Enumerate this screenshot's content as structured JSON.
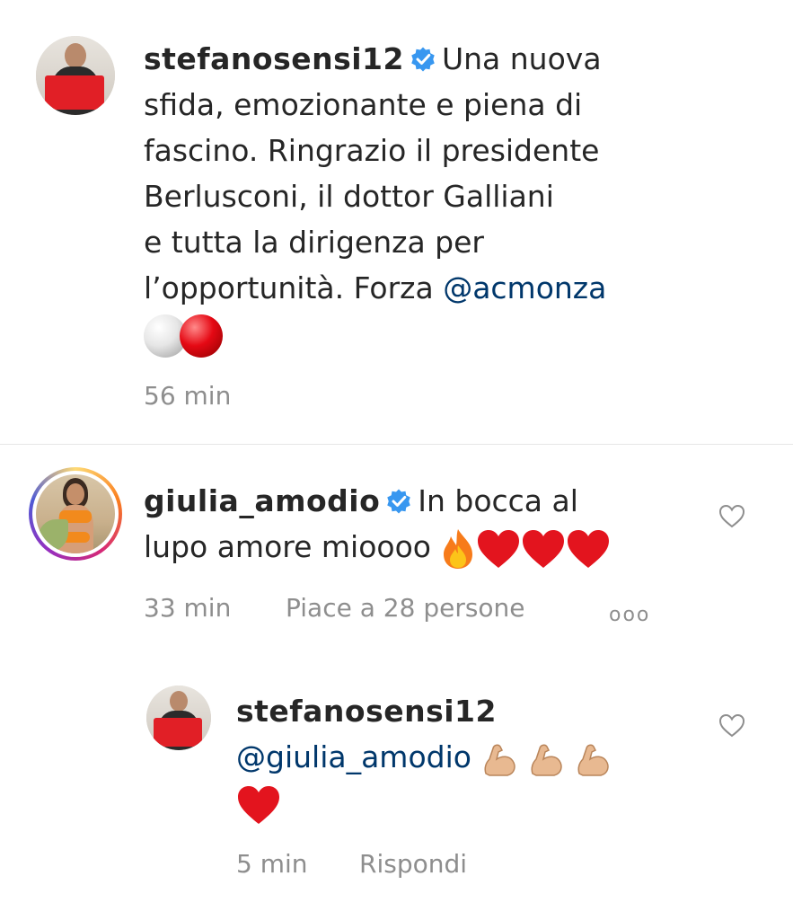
{
  "comments": [
    {
      "username": "stefanosensi12",
      "verified": true,
      "text_parts": [
        "Una nuova",
        "sfida, emozionante e piena di",
        "fascino. Ringrazio il presidente",
        "Berlusconi, il dottor Galliani",
        "e tutta la dirigenza per",
        "l’opportunità. Forza "
      ],
      "mention": "@acmonza",
      "time": "56 min"
    },
    {
      "username": "giulia_amodio",
      "verified": true,
      "text_line1": "In bocca al",
      "text_line2": "lupo amore mioooo",
      "time": "33 min",
      "likes": "Piace a 28 persone",
      "more": "ooo"
    },
    {
      "username": "stefanosensi12",
      "verified": false,
      "mention": "@giulia_amodio",
      "time": "5 min",
      "reply": "Rispondi"
    }
  ],
  "colors": {
    "text": "#262626",
    "meta": "#8e8e8e",
    "mention": "#00376b",
    "verified": "#3897f0"
  }
}
